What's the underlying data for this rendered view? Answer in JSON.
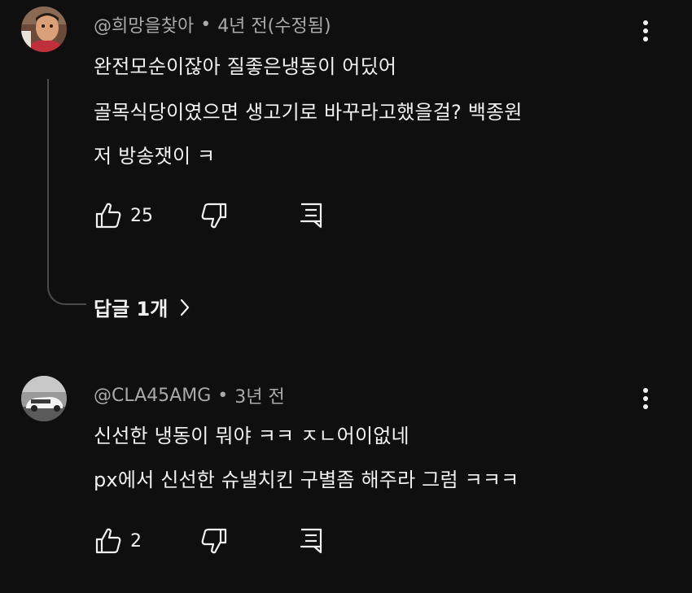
{
  "comments": [
    {
      "author": "@희망을찾아",
      "age": "4년 전",
      "edited": "(수정됨)",
      "lines": [
        "완전모순이잖아 질좋은냉동이 어딨어",
        "골목식당이였으면 생고기로 바꾸라고했을걸? 백종원",
        "저 방송잿이 ㅋ"
      ],
      "likes": "25",
      "replies_label": "답글 1개"
    },
    {
      "author": "@CLA45AMG",
      "age": "3년 전",
      "lines": [
        "신선한 냉동이 뭐야 ㅋㅋ ㅈㄴ어이없네",
        "px에서 신선한 슈낼치킨 구별좀 해주라 그럼 ㅋㅋㅋ"
      ],
      "likes": "2"
    }
  ],
  "meta_separator": "•",
  "icons": {
    "like": "thumbs-up-icon",
    "dislike": "thumbs-down-icon",
    "reply": "reply-comment-icon",
    "more": "more-vertical-icon",
    "chevron": "chevron-right-icon"
  },
  "colors": {
    "background": "#0f0f0f",
    "text": "#f1f1f1",
    "secondary_text": "#aaaaaa",
    "thread_line": "#4a4a4a"
  }
}
